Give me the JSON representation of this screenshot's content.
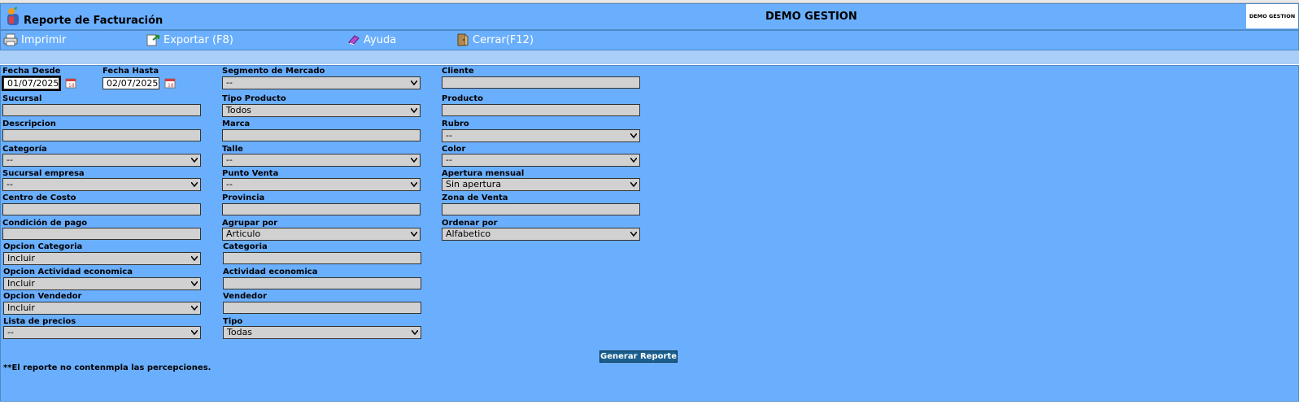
{
  "header": {
    "title": "Reporte de Facturación",
    "company": "DEMO GESTION",
    "badge": "DEMO GESTION"
  },
  "toolbar": {
    "print_label": "Imprimir",
    "export_label": "Exportar (F8)",
    "help_label": "Ayuda",
    "close_label": "Cerrar(F12)"
  },
  "form": {
    "fecha_desde": {
      "label": "Fecha Desde",
      "value": "01/07/2025"
    },
    "fecha_hasta": {
      "label": "Fecha Hasta",
      "value": "02/07/2025"
    },
    "segmento": {
      "label": "Segmento de Mercado",
      "value": "--"
    },
    "cliente": {
      "label": "Cliente",
      "value": ""
    },
    "sucursal": {
      "label": "Sucursal",
      "value": ""
    },
    "tipo_producto": {
      "label": "Tipo Producto",
      "value": "Todos"
    },
    "producto": {
      "label": "Producto",
      "value": ""
    },
    "descripcion": {
      "label": "Descripcion",
      "value": ""
    },
    "marca": {
      "label": "Marca",
      "value": ""
    },
    "rubro": {
      "label": "Rubro",
      "value": "--"
    },
    "categoria": {
      "label": "Categoría",
      "value": "--"
    },
    "talle": {
      "label": "Talle",
      "value": "--"
    },
    "color": {
      "label": "Color",
      "value": "--"
    },
    "sucursal_empresa": {
      "label": "Sucursal empresa",
      "value": "--"
    },
    "punto_venta": {
      "label": "Punto Venta",
      "value": "--"
    },
    "apertura_mensual": {
      "label": "Apertura mensual",
      "value": "Sin apertura"
    },
    "centro_costo": {
      "label": "Centro de Costo",
      "value": ""
    },
    "provincia": {
      "label": "Provincia",
      "value": ""
    },
    "zona_venta": {
      "label": "Zona de Venta",
      "value": ""
    },
    "condicion_pago": {
      "label": "Condición de pago",
      "value": ""
    },
    "agrupar_por": {
      "label": "Agrupar por",
      "value": "Articulo"
    },
    "ordenar_por": {
      "label": "Ordenar por",
      "value": "Alfabetico"
    },
    "opcion_categoria": {
      "label": "Opcion Categoria",
      "value": "Incluir"
    },
    "categoria2": {
      "label": "Categoria",
      "value": ""
    },
    "opcion_actividad": {
      "label": "Opcion Actividad economica",
      "value": "Incluir"
    },
    "actividad": {
      "label": "Actividad economica",
      "value": ""
    },
    "opcion_vendedor": {
      "label": "Opcion Vendedor",
      "value": "Incluir"
    },
    "vendedor": {
      "label": "Vendedor",
      "value": ""
    },
    "lista_precios": {
      "label": "Lista de precios",
      "value": "--"
    },
    "tipo": {
      "label": "Tipo",
      "value": "Todas"
    },
    "generate_label": "Generar Reporte",
    "note": "**El reporte no contenmpla las percepciones."
  }
}
